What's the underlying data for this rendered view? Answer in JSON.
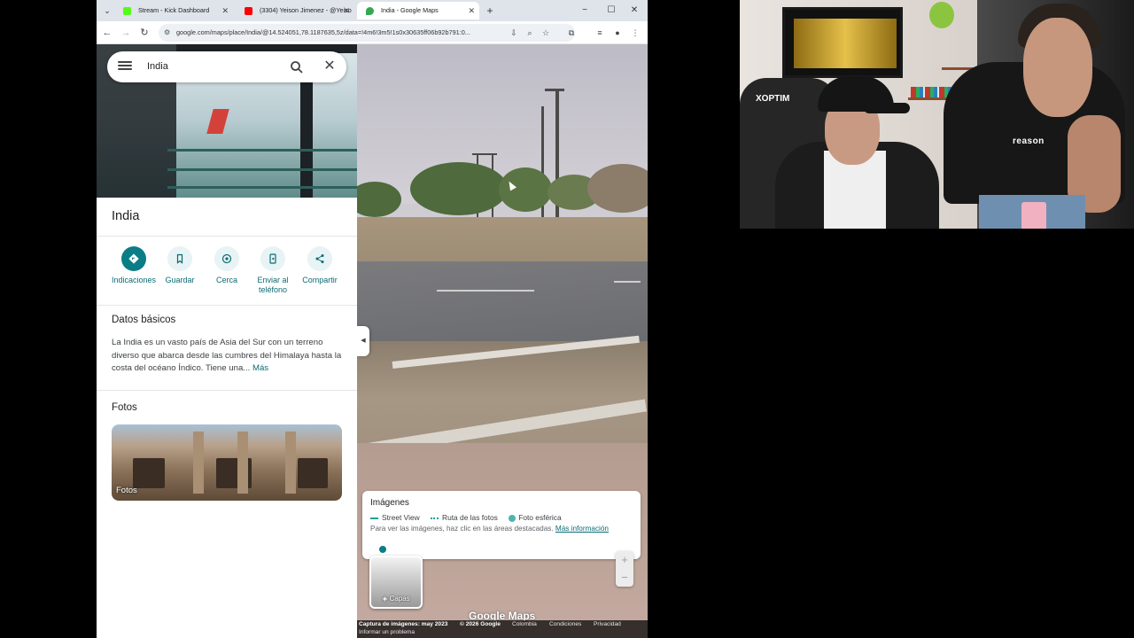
{
  "browser": {
    "tabs": [
      {
        "title": "Stream - Kick Dashboard",
        "favicon_color": "#53fc18",
        "active": false
      },
      {
        "title": "(3304) Yeison Jimenez - @Yeiso",
        "favicon_color": "#ff0000",
        "active": false
      },
      {
        "title": "India - Google Maps",
        "favicon_color": "#34a853",
        "active": true
      }
    ],
    "url": "google.com/maps/place/India/@14.524051,78.1187635,5z/data=!4m6!3m5!1s0x30635ff06b92b791:0..."
  },
  "maps": {
    "search_value": "India",
    "place_title": "India",
    "actions": [
      {
        "label": "Indicaciones",
        "icon": "directions-icon"
      },
      {
        "label": "Guardar",
        "icon": "bookmark-icon"
      },
      {
        "label": "Cerca",
        "icon": "nearby-icon"
      },
      {
        "label": "Enviar al teléfono",
        "icon": "send-to-phone-icon"
      },
      {
        "label": "Compartir",
        "icon": "share-icon"
      }
    ],
    "basics_title": "Datos básicos",
    "basics_text": "La India es un vasto país de Asia del Sur con un terreno diverso que abarca desde las cumbres del Himalaya hasta la costa del océano Índico. Tiene una...",
    "basics_more": "Más",
    "photos_title": "Fotos",
    "photo_label": "Fotos",
    "accent_color": "#0b7d87"
  },
  "streetview": {
    "card_title": "Imágenes",
    "legend": [
      "Street View",
      "Ruta de las fotos",
      "Foto esférica"
    ],
    "hint": "Para ver las imágenes, haz clic en las áreas destacadas.",
    "hint_link": "Más información",
    "layers_label": "Capas",
    "zoom_in": "+",
    "zoom_out": "−",
    "logo": "Google Maps",
    "footer": {
      "capture": "Captura de imágenes: may 2023",
      "copyright": "© 2026 Google",
      "country": "Colombia",
      "terms": "Condiciones",
      "privacy": "Privacidad",
      "report": "Informar un problema"
    }
  },
  "webcam": {
    "chair_brand": "XOPTIM",
    "shirt_text": "reason"
  }
}
